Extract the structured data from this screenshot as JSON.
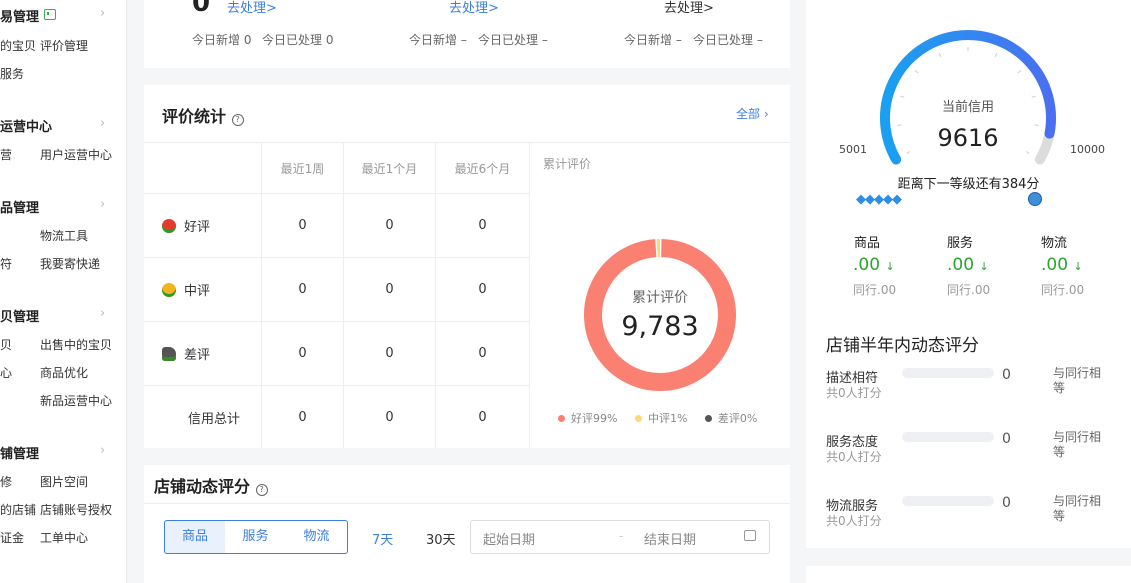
{
  "sidebar": {
    "sections": [
      {
        "title": "易管理",
        "items": [
          {
            "label": "的宝贝"
          },
          {
            "label": "评价管理"
          },
          {
            "label": "服务"
          }
        ]
      },
      {
        "title": "运营中心",
        "items": [
          {
            "label": "营"
          },
          {
            "label": "用户运营中心"
          }
        ]
      },
      {
        "title": "品管理",
        "items": [
          {
            "label": "物流工具"
          },
          {
            "label": "符"
          },
          {
            "label": "我要寄快递"
          }
        ]
      },
      {
        "title": "贝管理",
        "items": [
          {
            "label": "贝"
          },
          {
            "label": "出售中的宝贝"
          },
          {
            "label": "心"
          },
          {
            "label": "商品优化"
          },
          {
            "label": "新品运营中心"
          }
        ]
      },
      {
        "title": "铺管理",
        "items": [
          {
            "label": "修"
          },
          {
            "label": "图片空间"
          },
          {
            "label": "的店铺"
          },
          {
            "label": "店铺账号授权"
          },
          {
            "label": "证金"
          },
          {
            "label": "工单中心"
          }
        ]
      }
    ]
  },
  "top_stats": [
    {
      "value": "0",
      "action": "去处理>",
      "new_label": "今日新增 0",
      "done_label": "今日已处理 0"
    },
    {
      "value": "-",
      "action": "去处理>",
      "new_label": "今日新增 –",
      "done_label": "今日已处理 –"
    },
    {
      "value": "-",
      "action": "去处理>",
      "new_label": "今日新增 –",
      "done_label": "今日已处理 –"
    }
  ],
  "review_stats": {
    "title": "评价统计",
    "all_link": "全部",
    "columns": [
      "最近1周",
      "最近1个月",
      "最近6个月"
    ],
    "rows": [
      {
        "label": "好评",
        "icon": "red-flower-icon",
        "values": [
          "0",
          "0",
          "0"
        ]
      },
      {
        "label": "中评",
        "icon": "yellow-flower-icon",
        "values": [
          "0",
          "0",
          "0"
        ]
      },
      {
        "label": "差评",
        "icon": "wilted-flower-icon",
        "values": [
          "0",
          "0",
          "0"
        ]
      },
      {
        "label": "信用总计",
        "icon": "",
        "values": [
          "0",
          "0",
          "0"
        ]
      }
    ],
    "cumulative_title": "累计评价",
    "donut_label": "累计评价",
    "donut_value": "9,783"
  },
  "chart_data": {
    "type": "pie",
    "title": "累计评价",
    "categories": [
      "好评",
      "中评",
      "差评"
    ],
    "values": [
      99,
      1,
      0
    ],
    "total_label": "9,783",
    "legend": [
      {
        "label": "好评99%",
        "color": "#fa8072"
      },
      {
        "label": "中评1%",
        "color": "#fcd97a"
      },
      {
        "label": "差评0%",
        "color": "#555555"
      }
    ],
    "legend_position": "bottom"
  },
  "dynamic_rating": {
    "title": "店铺动态评分",
    "tabs": [
      "商品",
      "服务",
      "物流"
    ],
    "ranges": [
      "7天",
      "30天"
    ],
    "start_placeholder": "起始日期",
    "end_placeholder": "结束日期"
  },
  "credit": {
    "label": "当前信用",
    "value": "9616",
    "min": "5001",
    "max": "10000",
    "level": 0.92,
    "next_level_text": "距离下一等级还有384分",
    "metrics": [
      {
        "name": "商品",
        "value": ".00",
        "peer": "同行.00"
      },
      {
        "name": "服务",
        "value": ".00",
        "peer": "同行.00"
      },
      {
        "name": "物流",
        "value": ".00",
        "peer": "同行.00"
      }
    ]
  },
  "half_year": {
    "title": "店铺半年内动态评分",
    "rows": [
      {
        "name": "描述相符",
        "count": "共0人打分",
        "score": "0",
        "compare": "与同行相等"
      },
      {
        "name": "服务态度",
        "count": "共0人打分",
        "score": "0",
        "compare": "与同行相等"
      },
      {
        "name": "物流服务",
        "count": "共0人打分",
        "score": "0",
        "compare": "与同行相等"
      }
    ]
  },
  "colors": {
    "accent": "#3d7fe0",
    "donut_good": "#fa8072",
    "donut_mid": "#fcd97a",
    "donut_bad": "#555555",
    "up_green": "#2aa52e",
    "gauge_start": "#1aa0f0",
    "gauge_end": "#4a6ff0"
  }
}
